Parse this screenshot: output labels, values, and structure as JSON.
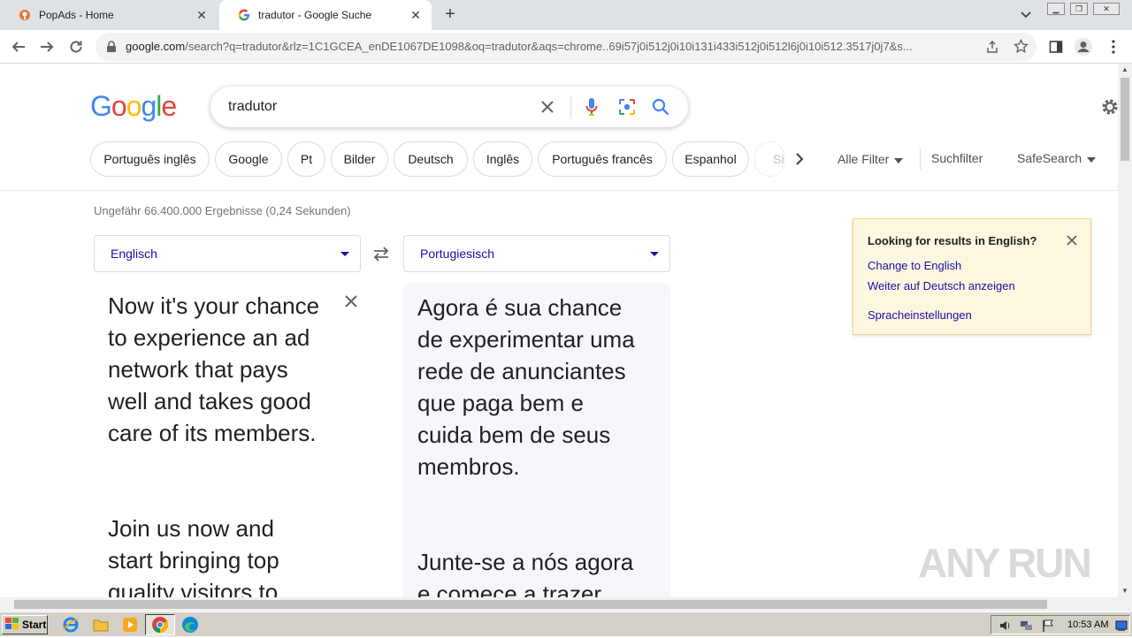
{
  "browser": {
    "tabs": [
      {
        "title": "PopAds - Home",
        "active": false,
        "favicon": "popads-icon"
      },
      {
        "title": "tradutor - Google Suche",
        "active": true,
        "favicon": "google-g-icon"
      }
    ],
    "url_host": "google.com",
    "url_rest": "/search?q=tradutor&rlz=1C1GCEA_enDE1067DE1098&oq=tradutor&aqs=chrome..69i57j0i512j0i10i131i433i512j0i512l6j0i10i512.3517j0j7&s..."
  },
  "google": {
    "logo": [
      "G",
      "o",
      "o",
      "g",
      "l",
      "e"
    ],
    "logo_colors": [
      "#4285f4",
      "#ea4335",
      "#fbbc05",
      "#4285f4",
      "#34a853",
      "#ea4335"
    ],
    "query": "tradutor",
    "chips": [
      "Português inglês",
      "Google",
      "Pt",
      "Bilder",
      "Deutsch",
      "Inglês",
      "Português francês",
      "Espanhol",
      "Si"
    ],
    "all_filters": "Alle Filter",
    "search_tools": "Suchfilter",
    "safesearch": "SafeSearch",
    "stats": "Ungefähr 66.400.000 Ergebnisse (0,24 Sekunden)"
  },
  "translate": {
    "source_lang": "Englisch",
    "target_lang": "Portugiesisch",
    "source_p1": [
      "Now it's your chance",
      "to experience an ad",
      "network that pays",
      "well and takes good",
      "care of its members."
    ],
    "source_p2": [
      "Join us now and",
      "start bringing top",
      "quality visitors to"
    ],
    "target_p1": [
      "Agora é sua chance",
      "de experimentar uma",
      "rede de anunciantes",
      "que paga bem e",
      "cuida bem de seus",
      "membros."
    ],
    "target_p2": [
      "Junte-se a nós agora",
      "e comece a trazer"
    ]
  },
  "notice": {
    "heading": "Looking for results in English?",
    "change_link": "Change to English",
    "keep_link": "Weiter auf Deutsch anzeigen",
    "settings_link": "Spracheinstellungen"
  },
  "watermark": "ANY RUN",
  "taskbar": {
    "start_label": "Start",
    "clock": "10:53 AM"
  }
}
